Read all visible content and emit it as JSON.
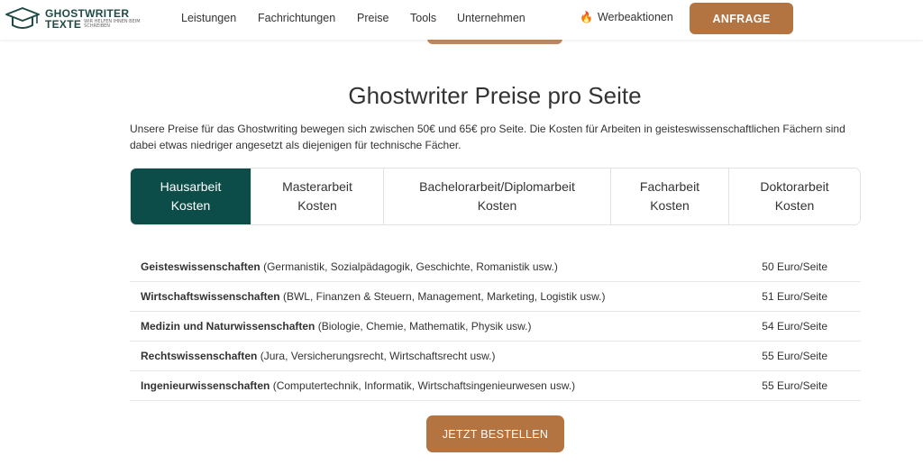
{
  "header": {
    "logo": {
      "line1": "GHOSTWRITER",
      "line2": "TEXTE",
      "tagline": "WIR HELFEN IHNEN BEIM SCHREIBEN"
    },
    "nav": [
      "Leistungen",
      "Fachrichtungen",
      "Preise",
      "Tools",
      "Unternehmen"
    ],
    "promo_label": "Werbeaktionen",
    "cta_label": "ANFRAGE"
  },
  "main": {
    "title": "Ghostwriter Preise pro Seite",
    "intro": "Unsere Preise für das Ghostwriting bewegen sich zwischen 50€ und 65€ pro Seite. Die Kosten für Arbeiten in geisteswissenschaftlichen Fächern sind dabei etwas niedriger angesetzt als diejenigen für technische Fächer.",
    "tabs": [
      {
        "line1": "Hausarbeit",
        "line2": "Kosten",
        "active": true
      },
      {
        "line1": "Masterarbeit",
        "line2": "Kosten",
        "active": false
      },
      {
        "line1": "Bachelorarbeit/Diplomarbeit",
        "line2": "Kosten",
        "active": false
      },
      {
        "line1": "Facharbeit",
        "line2": "Kosten",
        "active": false
      },
      {
        "line1": "Doktorarbeit",
        "line2": "Kosten",
        "active": false
      }
    ],
    "rows": [
      {
        "field": "Geisteswissenschaften",
        "examples": "(Germanistik, Sozialpädagogik, Geschichte, Romanistik usw.)",
        "price": "50 Euro/Seite"
      },
      {
        "field": "Wirtschaftswissenschaften",
        "examples": "(BWL, Finanzen & Steuern, Management, Marketing, Logistik usw.)",
        "price": "51 Euro/Seite"
      },
      {
        "field": "Medizin und Naturwissenschaften",
        "examples": "(Biologie, Chemie, Mathematik, Physik usw.)",
        "price": "54 Euro/Seite"
      },
      {
        "field": "Rechtswissenschaften",
        "examples": "(Jura, Versicherungsrecht, Wirtschaftsrecht usw.)",
        "price": "55 Euro/Seite"
      },
      {
        "field": "Ingenieurwissenschaften",
        "examples": "(Computertechnik, Informatik, Wirtschaftsingenieurwesen usw.)",
        "price": "55 Euro/Seite"
      }
    ],
    "order_label": "JETZT BESTELLEN"
  },
  "colors": {
    "accent": "#b47442",
    "tab_active": "#0d4d49",
    "logo": "#1f4a45"
  },
  "icons": {
    "logo": "graduation-cap-icon",
    "promo": "flame-icon"
  }
}
